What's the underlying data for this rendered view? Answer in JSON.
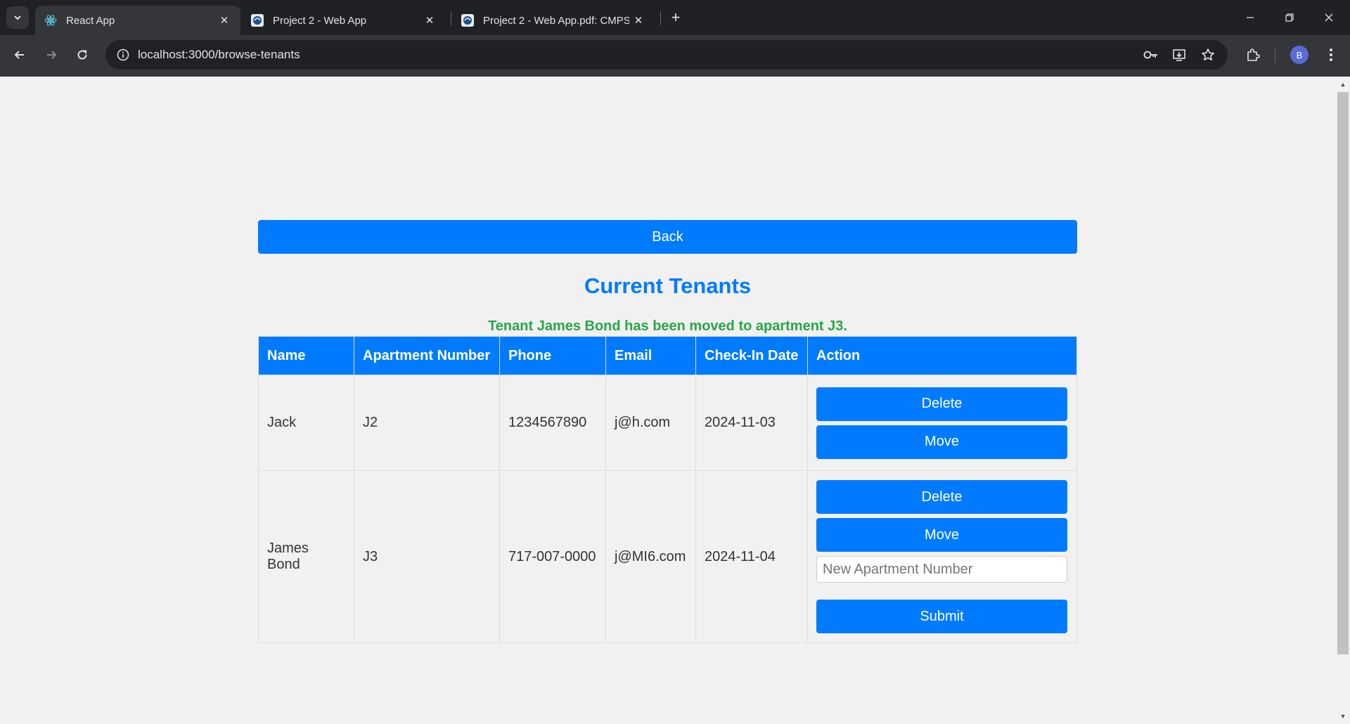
{
  "browser": {
    "tabs": [
      {
        "title": "React App",
        "active": true,
        "favicon": "react-icon"
      },
      {
        "title": "Project 2 - Web App",
        "active": false,
        "favicon": "doc-icon"
      },
      {
        "title": "Project 2 - Web App.pdf: CMPSC",
        "active": false,
        "favicon": "doc-icon"
      }
    ],
    "url": "localhost:3000/browse-tenants",
    "avatar_letter": "B"
  },
  "page": {
    "back_label": "Back",
    "title": "Current Tenants",
    "status_message": "Tenant James Bond has been moved to apartment J3.",
    "table": {
      "columns": [
        "Name",
        "Apartment Number",
        "Phone",
        "Email",
        "Check-In Date",
        "Action"
      ],
      "rows": [
        {
          "name": "Jack",
          "apartment": "J2",
          "phone": "1234567890",
          "email": "j@h.com",
          "checkin": "2024-11-03",
          "delete_label": "Delete",
          "move_label": "Move"
        },
        {
          "name": "James Bond",
          "apartment": "J3",
          "phone": "717-007-0000",
          "email": "j@MI6.com",
          "checkin": "2024-11-04",
          "delete_label": "Delete",
          "move_label": "Move",
          "input_placeholder": "New Apartment Number",
          "submit_label": "Submit"
        }
      ]
    }
  },
  "colors": {
    "accent": "#007bff",
    "success": "#28a745"
  }
}
